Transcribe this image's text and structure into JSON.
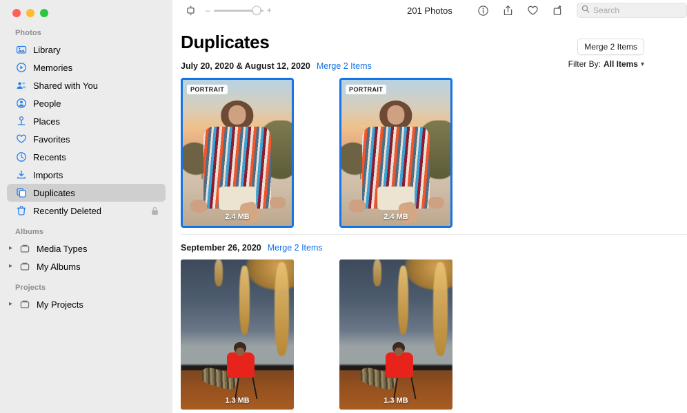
{
  "window": {
    "traffic_lights": [
      "close",
      "minimize",
      "zoom"
    ]
  },
  "toolbar": {
    "view_mode_icon": "aspect-icon",
    "zoom_minus": "–",
    "zoom_plus": "+",
    "zoom_value": 86,
    "photo_count": "201 Photos",
    "icons": [
      "info-icon",
      "share-icon",
      "favorite-icon",
      "rotate-icon"
    ],
    "search": {
      "placeholder": "Search",
      "value": ""
    }
  },
  "sidebar": {
    "sections": [
      {
        "title": "Photos",
        "items": [
          {
            "label": "Library",
            "icon": "library-icon",
            "selected": false,
            "locked": false,
            "disclosure": false
          },
          {
            "label": "Memories",
            "icon": "memories-icon",
            "selected": false,
            "locked": false,
            "disclosure": false
          },
          {
            "label": "Shared with You",
            "icon": "shared-with-you-icon",
            "selected": false,
            "locked": false,
            "disclosure": false
          },
          {
            "label": "People",
            "icon": "people-icon",
            "selected": false,
            "locked": false,
            "disclosure": false
          },
          {
            "label": "Places",
            "icon": "places-icon",
            "selected": false,
            "locked": false,
            "disclosure": false
          },
          {
            "label": "Favorites",
            "icon": "favorites-icon",
            "selected": false,
            "locked": false,
            "disclosure": false
          },
          {
            "label": "Recents",
            "icon": "recents-icon",
            "selected": false,
            "locked": false,
            "disclosure": false
          },
          {
            "label": "Imports",
            "icon": "imports-icon",
            "selected": false,
            "locked": false,
            "disclosure": false
          },
          {
            "label": "Duplicates",
            "icon": "duplicates-icon",
            "selected": true,
            "locked": false,
            "disclosure": false
          },
          {
            "label": "Recently Deleted",
            "icon": "trash-icon",
            "selected": false,
            "locked": true,
            "disclosure": false
          }
        ]
      },
      {
        "title": "Albums",
        "items": [
          {
            "label": "Media Types",
            "icon": "folder-icon",
            "selected": false,
            "locked": false,
            "disclosure": true
          },
          {
            "label": "My Albums",
            "icon": "folder-icon",
            "selected": false,
            "locked": false,
            "disclosure": true
          }
        ]
      },
      {
        "title": "Projects",
        "items": [
          {
            "label": "My Projects",
            "icon": "folder-icon",
            "selected": false,
            "locked": false,
            "disclosure": true
          }
        ]
      }
    ]
  },
  "main": {
    "title": "Duplicates",
    "merge_all_label": "Merge 2 Items",
    "filter_label": "Filter By:",
    "filter_value": "All Items",
    "groups": [
      {
        "date": "July 20, 2020 & August 12, 2020",
        "merge_link": "Merge 2 Items",
        "photos": [
          {
            "badge": "PORTRAIT",
            "filesize": "2.4 MB",
            "selected": true,
            "scene": "sunset-portrait"
          },
          {
            "badge": "PORTRAIT",
            "filesize": "2.4 MB",
            "selected": true,
            "scene": "sunset-portrait"
          }
        ]
      },
      {
        "date": "September 26, 2020",
        "merge_link": "Merge 2 Items",
        "photos": [
          {
            "badge": "",
            "filesize": "1.3 MB",
            "selected": false,
            "scene": "night-lights"
          },
          {
            "badge": "",
            "filesize": "1.3 MB",
            "selected": false,
            "scene": "night-lights"
          }
        ]
      }
    ]
  },
  "colors": {
    "accent": "#1473e6",
    "sidebar_bg": "#ececec",
    "selected_row": "#cfcfcf",
    "link": "#1473e6"
  }
}
